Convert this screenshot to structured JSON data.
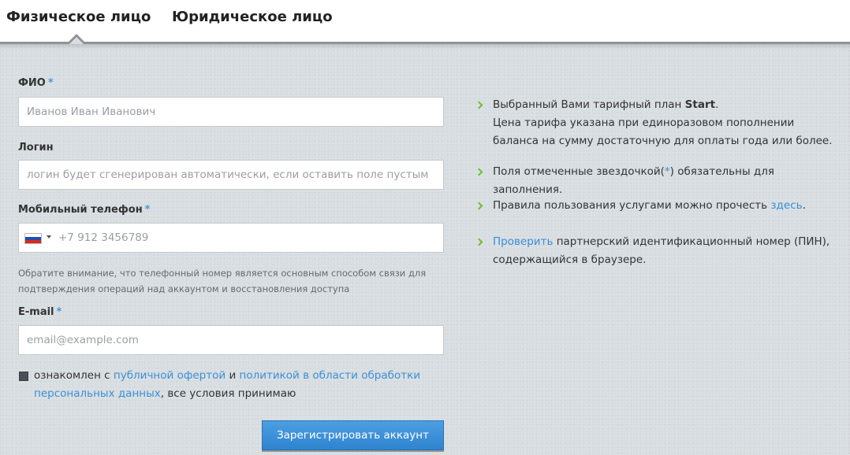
{
  "tabs": [
    {
      "label": "Физическое лицо",
      "active": true
    },
    {
      "label": "Юридическое лицо",
      "active": false
    }
  ],
  "form": {
    "fio": {
      "label": "ФИО",
      "required": "*",
      "placeholder": "Иванов Иван Иванович"
    },
    "login": {
      "label": "Логин",
      "placeholder": "логин будет сгенерирован автоматически, если оставить поле пустым"
    },
    "phone": {
      "label": "Мобильный телефон",
      "required": "*",
      "placeholder": "+7 912 3456789",
      "country_flag": "russia-flag-icon"
    },
    "phone_note": "Обратите внимание, что телефонный номер является основным способом связи для подтверждения операций над аккаунтом и восстановления доступа",
    "email": {
      "label": "E-mail",
      "required": "*",
      "placeholder": "email@example.com"
    },
    "agreement": {
      "prefix": "ознакомлен с ",
      "link1": "публичной офертой",
      "middle": " и ",
      "link2": "политикой в области обработки персональных данных",
      "suffix": ", все условия принимаю"
    },
    "submit_label": "Зарегистрировать аккаунт"
  },
  "info": {
    "plan_prefix": "Выбранный Вами тарифный план ",
    "plan_name": "Start",
    "plan_suffix": ".",
    "plan_note": "Цена тарифа указана при единоразовом пополнении баланса на сумму достаточную для оплаты года или более.",
    "required_prefix": "Поля отмеченные звездочкой(",
    "required_star": "*",
    "required_suffix": ") обязательны для заполнения.",
    "rules_prefix": "Правила пользования услугами можно прочесть ",
    "rules_link": "здесь",
    "rules_suffix": ".",
    "pin_link": "Проверить",
    "pin_text": " партнерский идентификационный номер (ПИН), содержащийся в браузере."
  },
  "colors": {
    "accent": "#3a8fd6",
    "chevron": "#6fbf2a",
    "panel_bg": "#d8dde1",
    "button": "#2f84cf"
  }
}
